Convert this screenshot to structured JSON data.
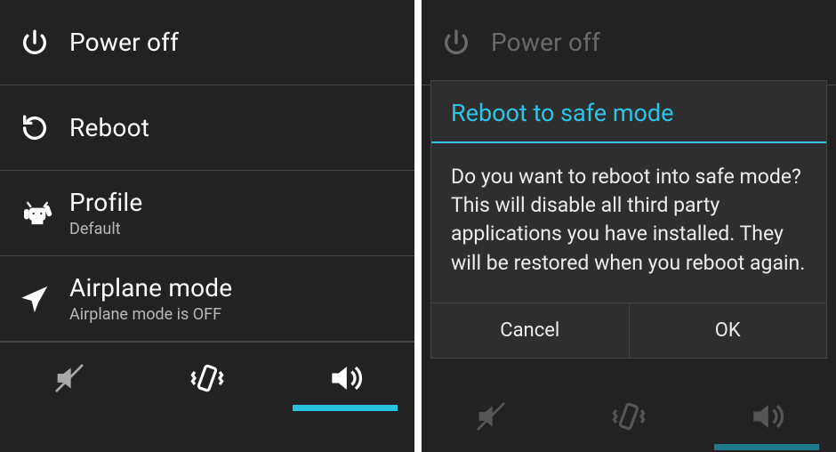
{
  "left": {
    "items": [
      {
        "icon": "power",
        "label": "Power off",
        "sub": ""
      },
      {
        "icon": "reboot",
        "label": "Reboot",
        "sub": ""
      },
      {
        "icon": "profile",
        "label": "Profile",
        "sub": "Default"
      },
      {
        "icon": "airplane",
        "label": "Airplane mode",
        "sub": "Airplane mode is OFF"
      }
    ],
    "sound_active_index": 2
  },
  "right": {
    "dim_header_label": "Power off",
    "dialog": {
      "title": "Reboot to safe mode",
      "body": "Do you want to reboot into safe mode? This will disable all third party applications you have installed. They will be restored when you reboot again.",
      "cancel": "Cancel",
      "ok": "OK"
    }
  },
  "colors": {
    "accent": "#2fc4e6"
  }
}
